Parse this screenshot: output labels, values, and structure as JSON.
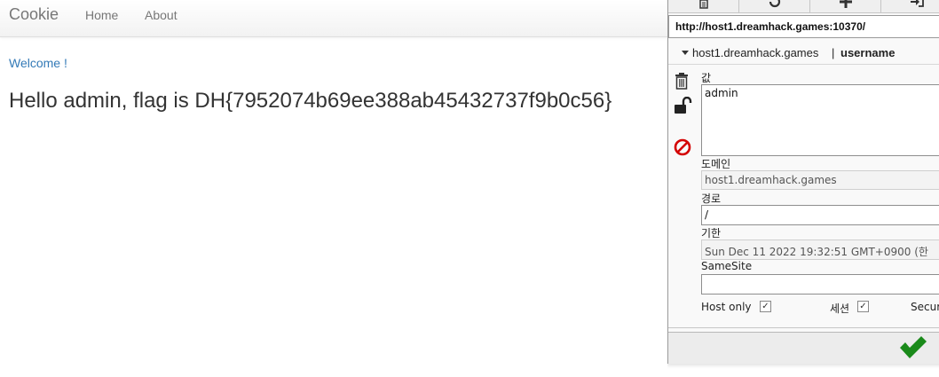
{
  "navbar": {
    "brand": "Cookie",
    "links": [
      "Home",
      "About"
    ]
  },
  "main": {
    "welcome": "Welcome !",
    "message": "Hello admin, flag is DH{7952074b69ee388ab45432737f9b0c56}"
  },
  "cookie_editor": {
    "toolbar": {
      "icons": [
        "delete-all-icon",
        "refresh-icon",
        "add-icon",
        "import-icon"
      ]
    },
    "url": "http://host1.dreamhack.games:10370/",
    "cookie": {
      "domain": "host1.dreamhack.games",
      "separator": "|",
      "name": "username"
    },
    "fields": {
      "value_label": "값",
      "value": "admin",
      "domain_label": "도메인",
      "domain": "host1.dreamhack.games",
      "path_label": "경로",
      "path": "/",
      "expiry_label": "기한",
      "expiry": "Sun Dec 11 2022 19:32:51 GMT+0900 (한",
      "samesite_label": "SameSite",
      "samesite": ""
    },
    "checkboxes": {
      "host_only_label": "Host only",
      "host_only_checked": true,
      "session_label": "세션",
      "session_checked": true,
      "secure_label": "Secur"
    },
    "colors": {
      "save_green": "#1a8a1a",
      "block_red": "#d40000",
      "link_blue": "#337ab7"
    }
  }
}
